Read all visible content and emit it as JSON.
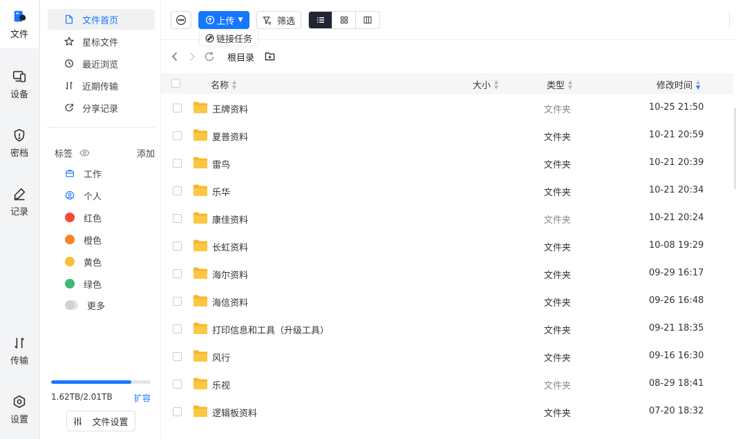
{
  "rail": {
    "files": "文件",
    "devices": "设备",
    "vault": "密档",
    "records": "记录",
    "transfer": "传输",
    "settings": "设置"
  },
  "sidebar": {
    "nav": [
      "文件首页",
      "星标文件",
      "最近浏览",
      "近期传输",
      "分享记录"
    ],
    "tags_title": "标签",
    "tags_add": "添加",
    "tags": [
      {
        "label": "工作",
        "icon": "briefcase-icon"
      },
      {
        "label": "个人",
        "icon": "user-circle-icon"
      },
      {
        "label": "红色",
        "color": "#f5483b"
      },
      {
        "label": "橙色",
        "color": "#f5842a"
      },
      {
        "label": "黄色",
        "color": "#fbbd34"
      },
      {
        "label": "绿色",
        "color": "#3fb97a"
      },
      {
        "label": "更多",
        "color": "#cfd2d6"
      }
    ],
    "storage_text": "1.62TB/2.01TB",
    "storage_used_fraction": 0.806,
    "storage_expand": "扩容",
    "file_settings": "文件设置"
  },
  "toolbar": {
    "upload": "上传",
    "link_task": "链接任务",
    "filter": "筛选"
  },
  "breadcrumb": {
    "root": "根目录"
  },
  "table": {
    "columns": {
      "name": "名称",
      "size": "大小",
      "type": "类型",
      "modified": "修改时间"
    },
    "rows": [
      {
        "name": "王牌资料",
        "type": "文件夹",
        "muted": true,
        "modified": "10-25 21:50"
      },
      {
        "name": "夏普资料",
        "type": "文件夹",
        "muted": false,
        "modified": "10-21 20:59"
      },
      {
        "name": "雷鸟",
        "type": "文件夹",
        "muted": false,
        "modified": "10-21 20:39"
      },
      {
        "name": "乐华",
        "type": "文件夹",
        "muted": false,
        "modified": "10-21 20:34"
      },
      {
        "name": "康佳资料",
        "type": "文件夹",
        "muted": true,
        "modified": "10-21 20:24"
      },
      {
        "name": "长虹资料",
        "type": "文件夹",
        "muted": false,
        "modified": "10-08 19:29"
      },
      {
        "name": "海尔资料",
        "type": "文件夹",
        "muted": false,
        "modified": "09-29 16:17"
      },
      {
        "name": "海信资料",
        "type": "文件夹",
        "muted": false,
        "modified": "09-26 16:48"
      },
      {
        "name": "打印信息和工具（升级工具）",
        "type": "文件夹",
        "muted": false,
        "modified": "09-21 18:35"
      },
      {
        "name": "风行",
        "type": "文件夹",
        "muted": false,
        "modified": "09-16 16:30"
      },
      {
        "name": "乐视",
        "type": "文件夹",
        "muted": true,
        "modified": "08-29 18:41"
      },
      {
        "name": "逻辑板资料",
        "type": "文件夹",
        "muted": false,
        "modified": "07-20 18:32"
      }
    ]
  },
  "colors": {
    "accent": "#1677ff",
    "folder": "#fbbd34",
    "active_view": "#1f2533"
  }
}
